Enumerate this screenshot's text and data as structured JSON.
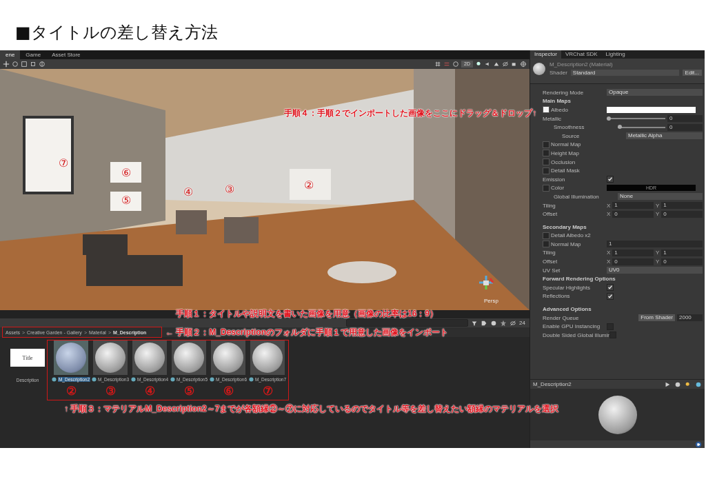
{
  "slide_title": "■タイトルの差し替え方法",
  "scene_tabs": [
    {
      "label": "ene",
      "selected": true
    },
    {
      "label": "Game",
      "selected": false
    },
    {
      "label": "Asset Store",
      "selected": false
    }
  ],
  "scene_toolbar": {
    "mode_2d": "2D"
  },
  "scene": {
    "kind": "picture",
    "frame_labels": [
      "⑦",
      "⑥",
      "⑤",
      "④",
      "③",
      "②"
    ],
    "gizmo_label": "Persp"
  },
  "project": {
    "hidden_count": "24",
    "breadcrumb": [
      "Assets",
      "Creative Garden - Gallery",
      "Material",
      "M_Description"
    ],
    "separator": ">",
    "assets": [
      {
        "kind": "texture",
        "thumb_text": "Title",
        "label": "Description",
        "selected": false
      },
      {
        "kind": "material",
        "label": "M_Description2",
        "selected": true
      },
      {
        "kind": "material",
        "label": "M_Description3",
        "selected": false
      },
      {
        "kind": "material",
        "label": "M_Description4",
        "selected": false
      },
      {
        "kind": "material",
        "label": "M_Description5",
        "selected": false
      },
      {
        "kind": "material",
        "label": "M_Description6",
        "selected": false
      },
      {
        "kind": "material",
        "label": "M_Description7",
        "selected": false
      }
    ],
    "frame_numbers": [
      "②",
      "③",
      "④",
      "⑤",
      "⑥",
      "⑦"
    ]
  },
  "annotations": [
    "手順４：手順２でインポートした画像をここにドラッグ＆ドロップ↑",
    "手順１：タイトルや説明文を書いた画像を用意（画像の比率は16：9）",
    "← 手順２：M_Descriptionのフォルダに手順１で用意した画像をインポート",
    "↑ 手順３：マテリアルM_Description2～7までが各額縁②～⑦に対応しているのでタイトル等を差し替えたい額縁のマテリアルを選択"
  ],
  "inspector": {
    "tabs": [
      {
        "label": "Inspector",
        "selected": true
      },
      {
        "label": "VRChat SDK",
        "selected": false
      },
      {
        "label": "Lighting",
        "selected": false
      }
    ],
    "title": "M_Description2 (Material)",
    "shader_label": "Shader",
    "shader": "Standard",
    "edit_button": "Edit...",
    "rows": [
      {
        "kind": "dropdown",
        "label": "Rendering Mode",
        "value": "Opaque"
      },
      {
        "kind": "header",
        "label": "Main Maps"
      },
      {
        "kind": "color_map",
        "label": "Albedo"
      },
      {
        "kind": "slider",
        "label": "Metallic",
        "level": 0,
        "value": "0"
      },
      {
        "kind": "sub_slider",
        "label": "Smoothness",
        "level": 0,
        "value": "0"
      },
      {
        "kind": "sub2_dropdown",
        "label": "Source",
        "value": "Metallic Alpha"
      },
      {
        "kind": "map",
        "label": "Normal Map"
      },
      {
        "kind": "map",
        "label": "Height Map"
      },
      {
        "kind": "map",
        "label": "Occlusion"
      },
      {
        "kind": "map",
        "label": "Detail Mask"
      },
      {
        "kind": "toggle",
        "label": "Emission",
        "checked": true
      },
      {
        "kind": "hdr_map",
        "label": "Color",
        "value": "HDR"
      },
      {
        "kind": "sub_dropdown",
        "label": "Global Illumination",
        "value": "None"
      },
      {
        "kind": "xy",
        "label": "Tiling",
        "fields": [
          {
            "axis": "X",
            "value": "1"
          },
          {
            "axis": "Y",
            "value": "1"
          }
        ]
      },
      {
        "kind": "xy",
        "label": "Offset",
        "fields": [
          {
            "axis": "X",
            "value": "0"
          },
          {
            "axis": "Y",
            "value": "0"
          }
        ]
      },
      {
        "kind": "spacer"
      },
      {
        "kind": "header",
        "label": "Secondary Maps"
      },
      {
        "kind": "map",
        "label": "Detail Albedo x2"
      },
      {
        "kind": "map_field",
        "label": "Normal Map",
        "value": "1"
      },
      {
        "kind": "xy",
        "label": "Tiling",
        "fields": [
          {
            "axis": "X",
            "value": "1"
          },
          {
            "axis": "Y",
            "value": "1"
          }
        ]
      },
      {
        "kind": "xy",
        "label": "Offset",
        "fields": [
          {
            "axis": "X",
            "value": "0"
          },
          {
            "axis": "Y",
            "value": "0"
          }
        ]
      },
      {
        "kind": "dropdown",
        "label": "UV Set",
        "value": "UV0"
      },
      {
        "kind": "header",
        "label": "Forward Rendering Options"
      },
      {
        "kind": "toggle",
        "label": "Specular Highlights",
        "checked": true
      },
      {
        "kind": "toggle",
        "label": "Reflections",
        "checked": true
      },
      {
        "kind": "spacer"
      },
      {
        "kind": "header",
        "label": "Advanced Options"
      },
      {
        "kind": "queue",
        "label": "Render Queue",
        "select": "From Shader",
        "value": "2000"
      },
      {
        "kind": "toggle",
        "label": "Enable GPU Instancing",
        "checked": false
      },
      {
        "kind": "toggle",
        "label": "Double Sided Global Illumir",
        "checked": false
      }
    ],
    "preview_title": "M_Description2"
  }
}
